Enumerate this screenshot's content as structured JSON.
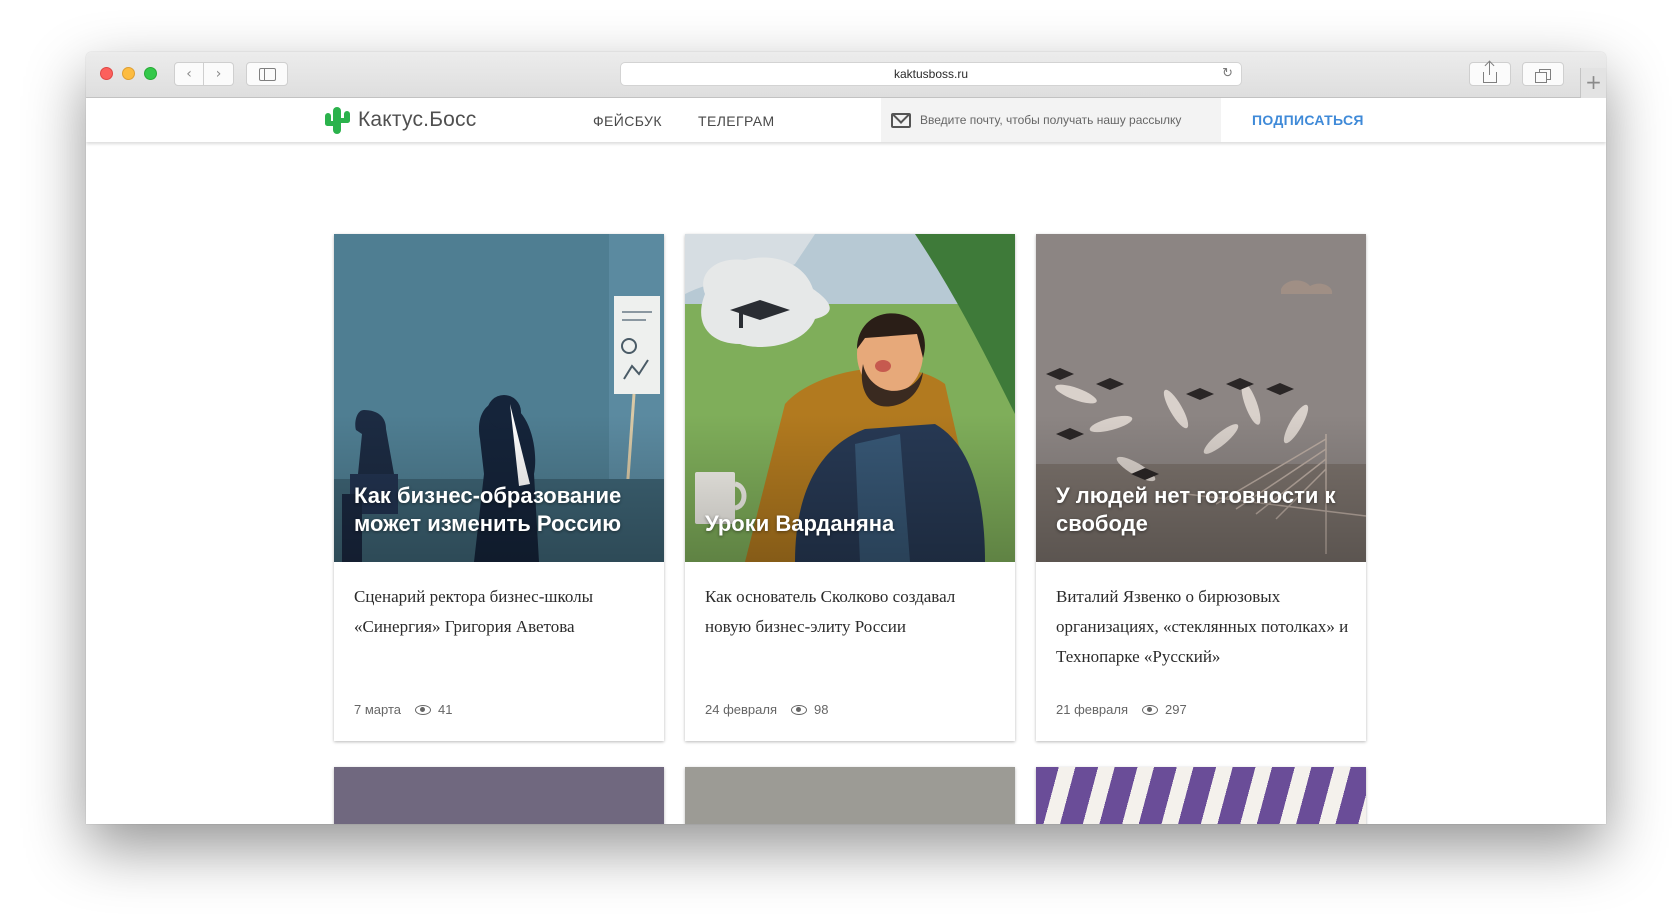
{
  "browser": {
    "url": "kaktusboss.ru",
    "icons": [
      "back-arrow-icon",
      "forward-arrow-icon",
      "sidebar-icon",
      "reload-icon",
      "share-icon",
      "tabs-icon",
      "new-tab-icon"
    ]
  },
  "site": {
    "logo_text": "Кактус.Босс",
    "nav": [
      {
        "label": "ФЕЙСБУК"
      },
      {
        "label": "ТЕЛЕГРАМ"
      }
    ],
    "subscribe": {
      "placeholder": "Введите почту, чтобы получать нашу рассылку",
      "button_label": "ПОДПИСАТЬСЯ"
    },
    "colors": {
      "logo_green": "#2bb24c",
      "accent_blue": "#3f8ad8"
    }
  },
  "cards": [
    {
      "title": "Как бизнес-образование может изменить Россию",
      "description": "Сценарий ректора бизнес-школы «Синергия» Григория Аветова",
      "date": "7 марта",
      "views": "41"
    },
    {
      "title": "Уроки Варданяна",
      "description": "Как основатель Сколково создавал новую бизнес-элиту России",
      "date": "24 февраля",
      "views": "98"
    },
    {
      "title": "У людей нет готовности к свободе",
      "description": "Виталий Язвенко о бирюзовых организациях, «стеклянных потолках» и Технопарке «Русский»",
      "date": "21 февраля",
      "views": "297"
    }
  ]
}
